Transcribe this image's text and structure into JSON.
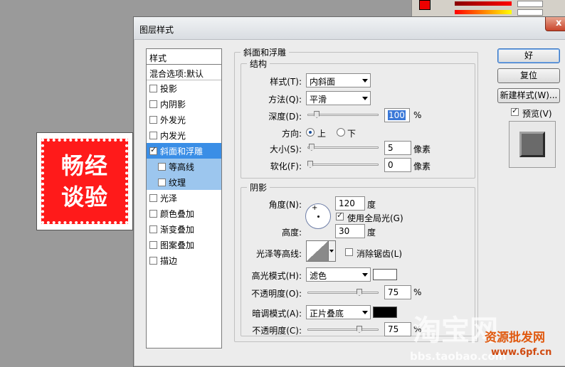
{
  "dialog": {
    "title": "图层样式",
    "close_glyph": "x"
  },
  "canvas": {
    "stamp_line1": "畅经",
    "stamp_line2": "谈验"
  },
  "sidebar": {
    "header": "样式",
    "blend_options": "混合选项:默认",
    "items": [
      {
        "label": "投影",
        "checked": false
      },
      {
        "label": "内阴影",
        "checked": false
      },
      {
        "label": "外发光",
        "checked": false
      },
      {
        "label": "内发光",
        "checked": false
      },
      {
        "label": "斜面和浮雕",
        "checked": true
      },
      {
        "label": "等高线",
        "checked": false
      },
      {
        "label": "纹理",
        "checked": false
      },
      {
        "label": "光泽",
        "checked": false
      },
      {
        "label": "颜色叠加",
        "checked": false
      },
      {
        "label": "渐变叠加",
        "checked": false
      },
      {
        "label": "图案叠加",
        "checked": false
      },
      {
        "label": "描边",
        "checked": false
      }
    ]
  },
  "bevel": {
    "section_title": "斜面和浮雕",
    "structure_title": "结构",
    "style_label": "样式(T):",
    "style_value": "内斜面",
    "technique_label": "方法(Q):",
    "technique_value": "平滑",
    "depth_label": "深度(D):",
    "depth_value": "100",
    "depth_unit": "%",
    "depth_level": 0.1,
    "direction_label": "方向:",
    "dir_up": "上",
    "dir_down": "下",
    "size_label": "大小(S):",
    "size_value": "5",
    "size_unit": "像素",
    "size_level": 0.02,
    "soften_label": "软化(F):",
    "soften_value": "0",
    "soften_unit": "像素",
    "soften_level": 0
  },
  "shading": {
    "title": "阴影",
    "angle_label": "角度(N):",
    "angle_value": "120",
    "angle_unit": "度",
    "global_light_label": "使用全局光(G)",
    "altitude_label": "高度:",
    "altitude_value": "30",
    "altitude_unit": "度",
    "gloss_contour_label": "光泽等高线:",
    "antialiased_label": "消除锯齿(L)",
    "highlight_mode_label": "高光模式(H):",
    "highlight_mode_value": "滤色",
    "highlight_color": "#ffffff",
    "highlight_opacity_label": "不透明度(O):",
    "highlight_opacity_value": "75",
    "highlight_opacity_unit": "%",
    "highlight_opacity_level": 0.75,
    "shadow_mode_label": "暗调模式(A):",
    "shadow_mode_value": "正片叠底",
    "shadow_color": "#000000",
    "shadow_opacity_label": "不透明度(C):",
    "shadow_opacity_value": "75",
    "shadow_opacity_unit": "%",
    "shadow_opacity_level": 0.75
  },
  "buttons": {
    "ok": "好",
    "reset": "复位",
    "new_style": "新建样式(W)...",
    "preview": "预览(V)"
  },
  "watermarks": {
    "site": "淘宝网",
    "url": "bbs.taobao.com",
    "brand": "资源批发网",
    "brand_url": "www.6pf.cn"
  }
}
